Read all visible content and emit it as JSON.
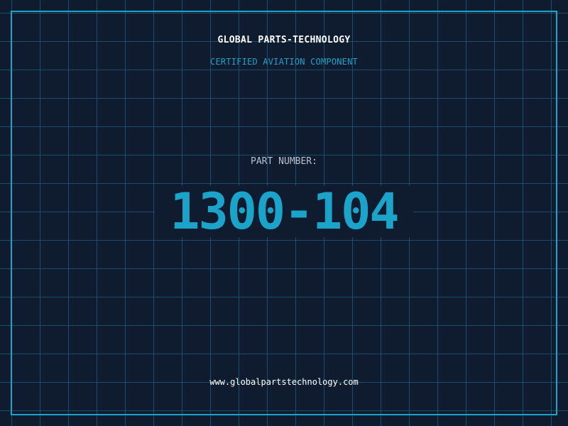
{
  "header": {
    "company": "GLOBAL PARTS-TECHNOLOGY",
    "tagline": "CERTIFIED AVIATION COMPONENT"
  },
  "part": {
    "label": "PART NUMBER:",
    "number": "1300-104"
  },
  "footer": {
    "website": "www.globalpartstechnology.com"
  },
  "colors": {
    "background": "#0f1b2e",
    "accent": "#1ba3c9",
    "grid": "#257896",
    "text": "#ffffff",
    "label": "#b6c2cf"
  }
}
